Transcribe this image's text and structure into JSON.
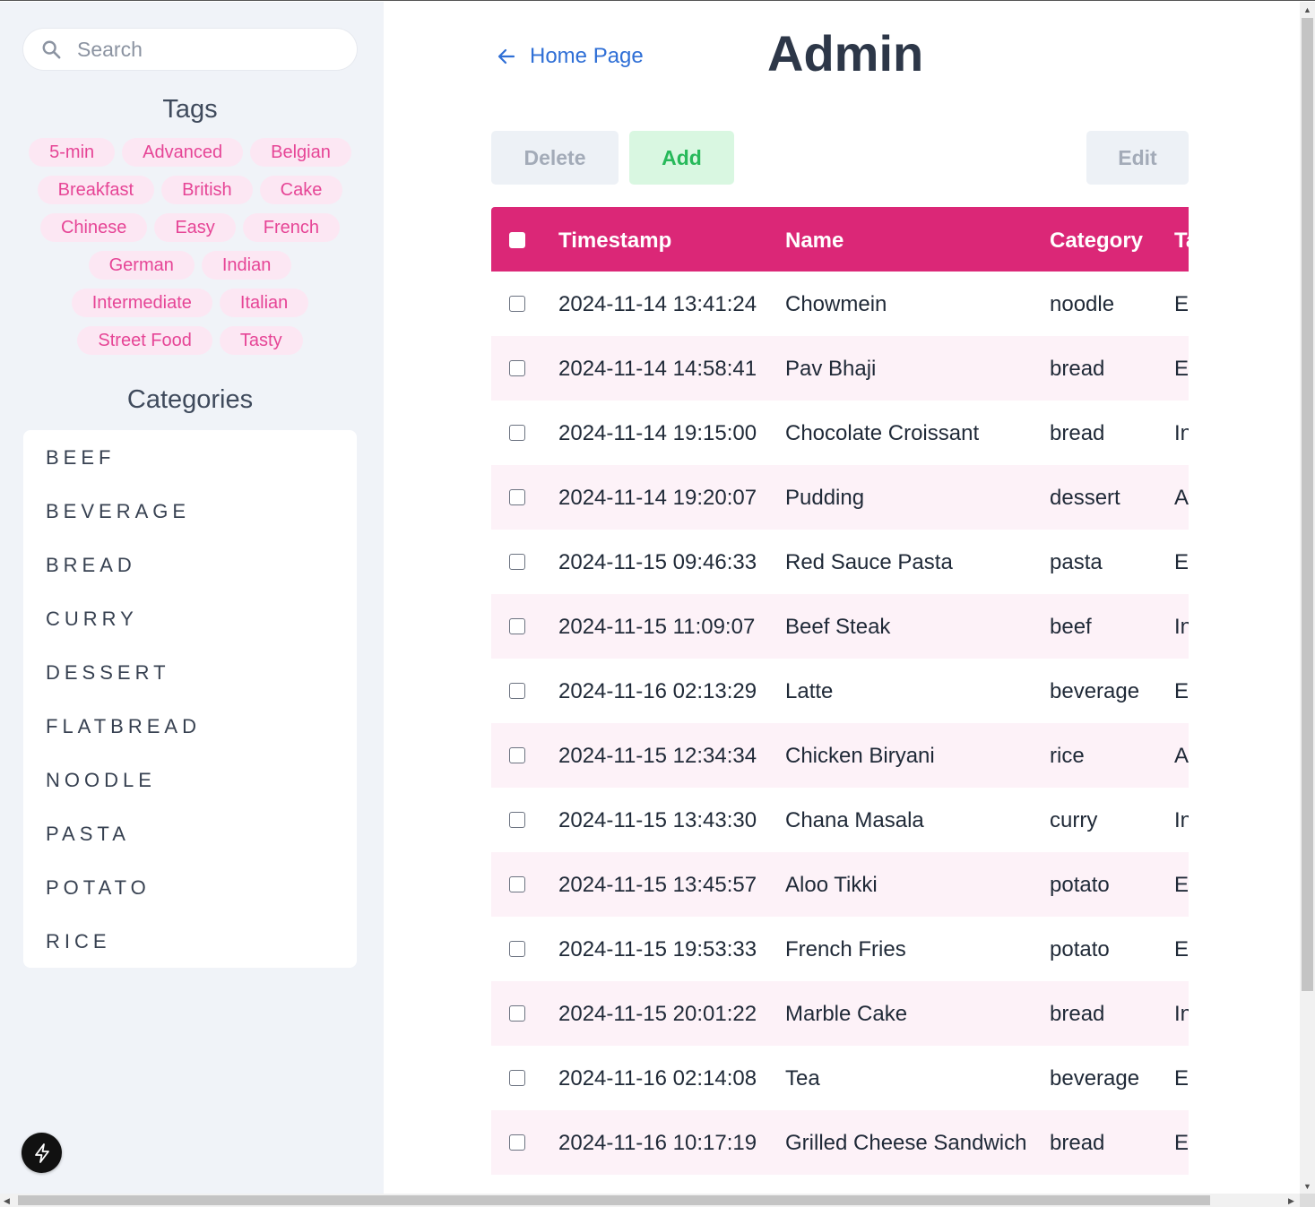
{
  "search": {
    "placeholder": "Search",
    "icon": "search-icon"
  },
  "tags_section": {
    "title": "Tags",
    "items": [
      "5-min",
      "Advanced",
      "Belgian",
      "Breakfast",
      "British",
      "Cake",
      "Chinese",
      "Easy",
      "French",
      "German",
      "Indian",
      "Intermediate",
      "Italian",
      "Street Food",
      "Tasty"
    ]
  },
  "categories_section": {
    "title": "Categories",
    "items": [
      "BEEF",
      "BEVERAGE",
      "BREAD",
      "CURRY",
      "DESSERT",
      "FLATBREAD",
      "NOODLE",
      "PASTA",
      "POTATO",
      "RICE"
    ]
  },
  "header": {
    "back_label": "Home Page",
    "title": "Admin"
  },
  "toolbar": {
    "delete_label": "Delete",
    "add_label": "Add",
    "edit_label": "Edit"
  },
  "table": {
    "columns": [
      "Timestamp",
      "Name",
      "Category",
      "Ta"
    ],
    "rows": [
      {
        "timestamp": "2024-11-14 13:41:24",
        "name": "Chowmein",
        "category": "noodle",
        "tag": "Ea"
      },
      {
        "timestamp": "2024-11-14 14:58:41",
        "name": "Pav Bhaji",
        "category": "bread",
        "tag": "Ea"
      },
      {
        "timestamp": "2024-11-14 19:15:00",
        "name": "Chocolate Croissant",
        "category": "bread",
        "tag": "In"
      },
      {
        "timestamp": "2024-11-14 19:20:07",
        "name": "Pudding",
        "category": "dessert",
        "tag": "A"
      },
      {
        "timestamp": "2024-11-15 09:46:33",
        "name": "Red Sauce Pasta",
        "category": "pasta",
        "tag": "Ea"
      },
      {
        "timestamp": "2024-11-15 11:09:07",
        "name": "Beef Steak",
        "category": "beef",
        "tag": "In"
      },
      {
        "timestamp": "2024-11-16 02:13:29",
        "name": "Latte",
        "category": "beverage",
        "tag": "Ea"
      },
      {
        "timestamp": "2024-11-15 12:34:34",
        "name": "Chicken Biryani",
        "category": "rice",
        "tag": "A"
      },
      {
        "timestamp": "2024-11-15 13:43:30",
        "name": "Chana Masala",
        "category": "curry",
        "tag": "In"
      },
      {
        "timestamp": "2024-11-15 13:45:57",
        "name": "Aloo Tikki",
        "category": "potato",
        "tag": "Ea"
      },
      {
        "timestamp": "2024-11-15 19:53:33",
        "name": "French Fries",
        "category": "potato",
        "tag": "Ea"
      },
      {
        "timestamp": "2024-11-15 20:01:22",
        "name": "Marble Cake",
        "category": "bread",
        "tag": "In"
      },
      {
        "timestamp": "2024-11-16 02:14:08",
        "name": "Tea",
        "category": "beverage",
        "tag": "Ea"
      },
      {
        "timestamp": "2024-11-16 10:17:19",
        "name": "Grilled Cheese Sandwich",
        "category": "bread",
        "tag": "Ea"
      }
    ]
  },
  "colors": {
    "accent": "#db2777",
    "tag_bg": "#fce7f3",
    "tag_text": "#e64596",
    "link": "#2f6fd6",
    "add_bg": "#d9f7e1",
    "add_text": "#27b95a",
    "sidebar_bg": "#f0f3f8"
  },
  "icons": {
    "back": "arrow-left-icon",
    "bolt": "lightning-bolt-icon"
  }
}
